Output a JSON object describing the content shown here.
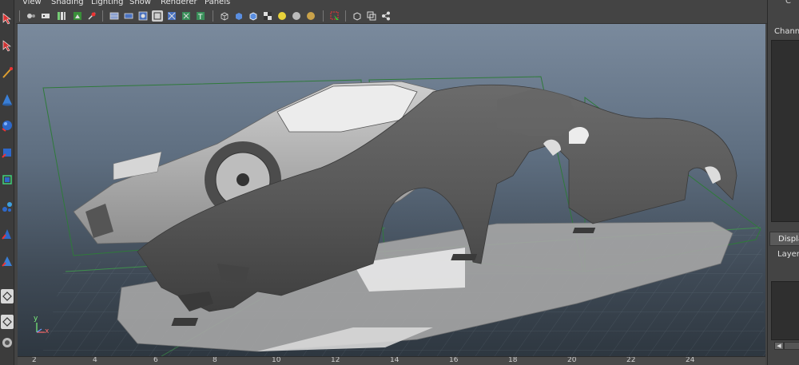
{
  "menubar": {
    "items": [
      "View",
      "Shading",
      "Lighting",
      "Show",
      "Renderer",
      "Panels"
    ]
  },
  "toolbox": {
    "tools": [
      "select-tool",
      "lasso-tool",
      "paint-select-tool",
      "cone-tool",
      "sphere-tool",
      "move-tool",
      "rotate-tool",
      "scale-tool",
      "manipulator-tool",
      "soft-mod-tool",
      "show-manipulator-tool",
      "last-tool",
      "layout-single",
      "layout-four",
      "layout-outliner"
    ]
  },
  "viewport": {
    "axis_y": "y",
    "axis_x": "x"
  },
  "timeline": {
    "ticks": [
      "2",
      "4",
      "6",
      "8",
      "10",
      "12",
      "14",
      "16",
      "18",
      "20",
      "22",
      "24"
    ]
  },
  "right_panel": {
    "header_letter": "C",
    "channel_box_tab": "Channel",
    "display_tab": "Displa",
    "layers_label": "Layers",
    "scroll_left_glyph": "◀"
  },
  "colors": {
    "viewport_top": "#7a8a9d",
    "viewport_bottom": "#2e3740",
    "panel_bg": "#444444",
    "grid_green": "#3fa04a"
  }
}
